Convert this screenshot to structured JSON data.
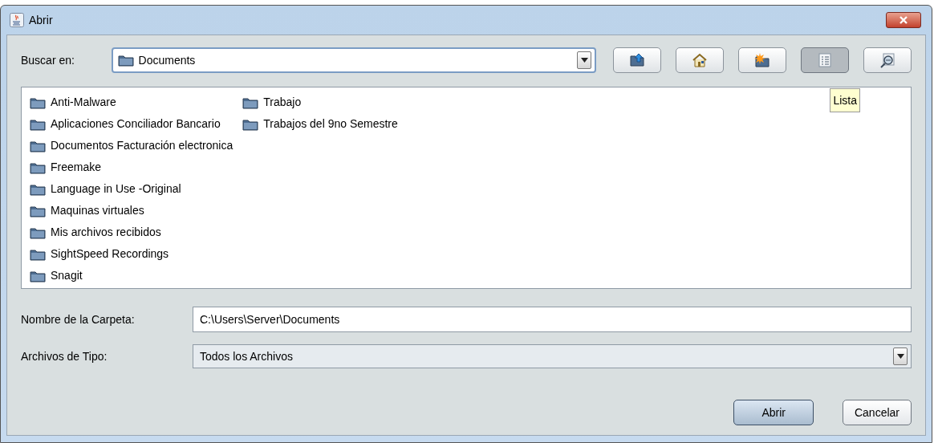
{
  "window": {
    "title": "Abrir"
  },
  "look_in": {
    "label": "Buscar en:",
    "value": "Documents"
  },
  "toolbar": [
    {
      "kind": "up",
      "selected": false
    },
    {
      "kind": "home",
      "selected": false
    },
    {
      "kind": "new-folder",
      "selected": false
    },
    {
      "kind": "list",
      "selected": true
    },
    {
      "kind": "details",
      "selected": false
    }
  ],
  "tooltip": "Lista",
  "files": [
    {
      "name": "Anti-Malware"
    },
    {
      "name": "Aplicaciones Conciliador Bancario"
    },
    {
      "name": "Documentos Facturación electronica"
    },
    {
      "name": "Freemake"
    },
    {
      "name": "Language in Use -Original"
    },
    {
      "name": "Maquinas virtuales"
    },
    {
      "name": "Mis archivos recibidos"
    },
    {
      "name": "SightSpeed Recordings"
    },
    {
      "name": "Snagit"
    },
    {
      "name": "Trabajo"
    },
    {
      "name": "Trabajos del 9no Semestre"
    }
  ],
  "folder_name": {
    "label": "Nombre de la Carpeta:",
    "value": "C:\\Users\\Server\\Documents"
  },
  "file_type": {
    "label": "Archivos de Tipo:",
    "value": "Todos los Archivos"
  },
  "buttons": [
    {
      "label": "Abrir",
      "default": true
    },
    {
      "label": "Cancelar",
      "default": false
    }
  ]
}
